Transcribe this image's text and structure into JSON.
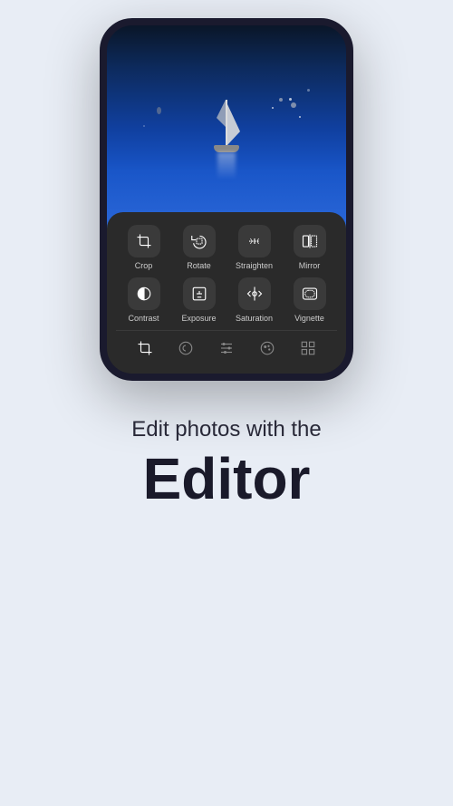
{
  "phone": {
    "tools_row1": [
      {
        "id": "crop",
        "label": "Crop",
        "icon": "crop"
      },
      {
        "id": "rotate",
        "label": "Rotate",
        "icon": "rotate"
      },
      {
        "id": "straighten",
        "label": "Straighten",
        "icon": "straighten"
      },
      {
        "id": "mirror",
        "label": "Mirror",
        "icon": "mirror"
      }
    ],
    "tools_row2": [
      {
        "id": "contrast",
        "label": "Contrast",
        "icon": "contrast"
      },
      {
        "id": "exposure",
        "label": "Exposure",
        "icon": "exposure"
      },
      {
        "id": "saturation",
        "label": "Saturation",
        "icon": "saturation"
      },
      {
        "id": "vignette",
        "label": "Vignette",
        "icon": "vignette"
      }
    ],
    "nav_items": [
      {
        "id": "crop-nav",
        "label": "crop",
        "active": true
      },
      {
        "id": "color-nav",
        "label": "color",
        "active": false
      },
      {
        "id": "adjust-nav",
        "label": "adjust",
        "active": false
      },
      {
        "id": "paint-nav",
        "label": "paint",
        "active": false
      },
      {
        "id": "grid-nav",
        "label": "grid",
        "active": false
      }
    ]
  },
  "text": {
    "subtitle": "Edit photos with the",
    "title": "Editor"
  }
}
